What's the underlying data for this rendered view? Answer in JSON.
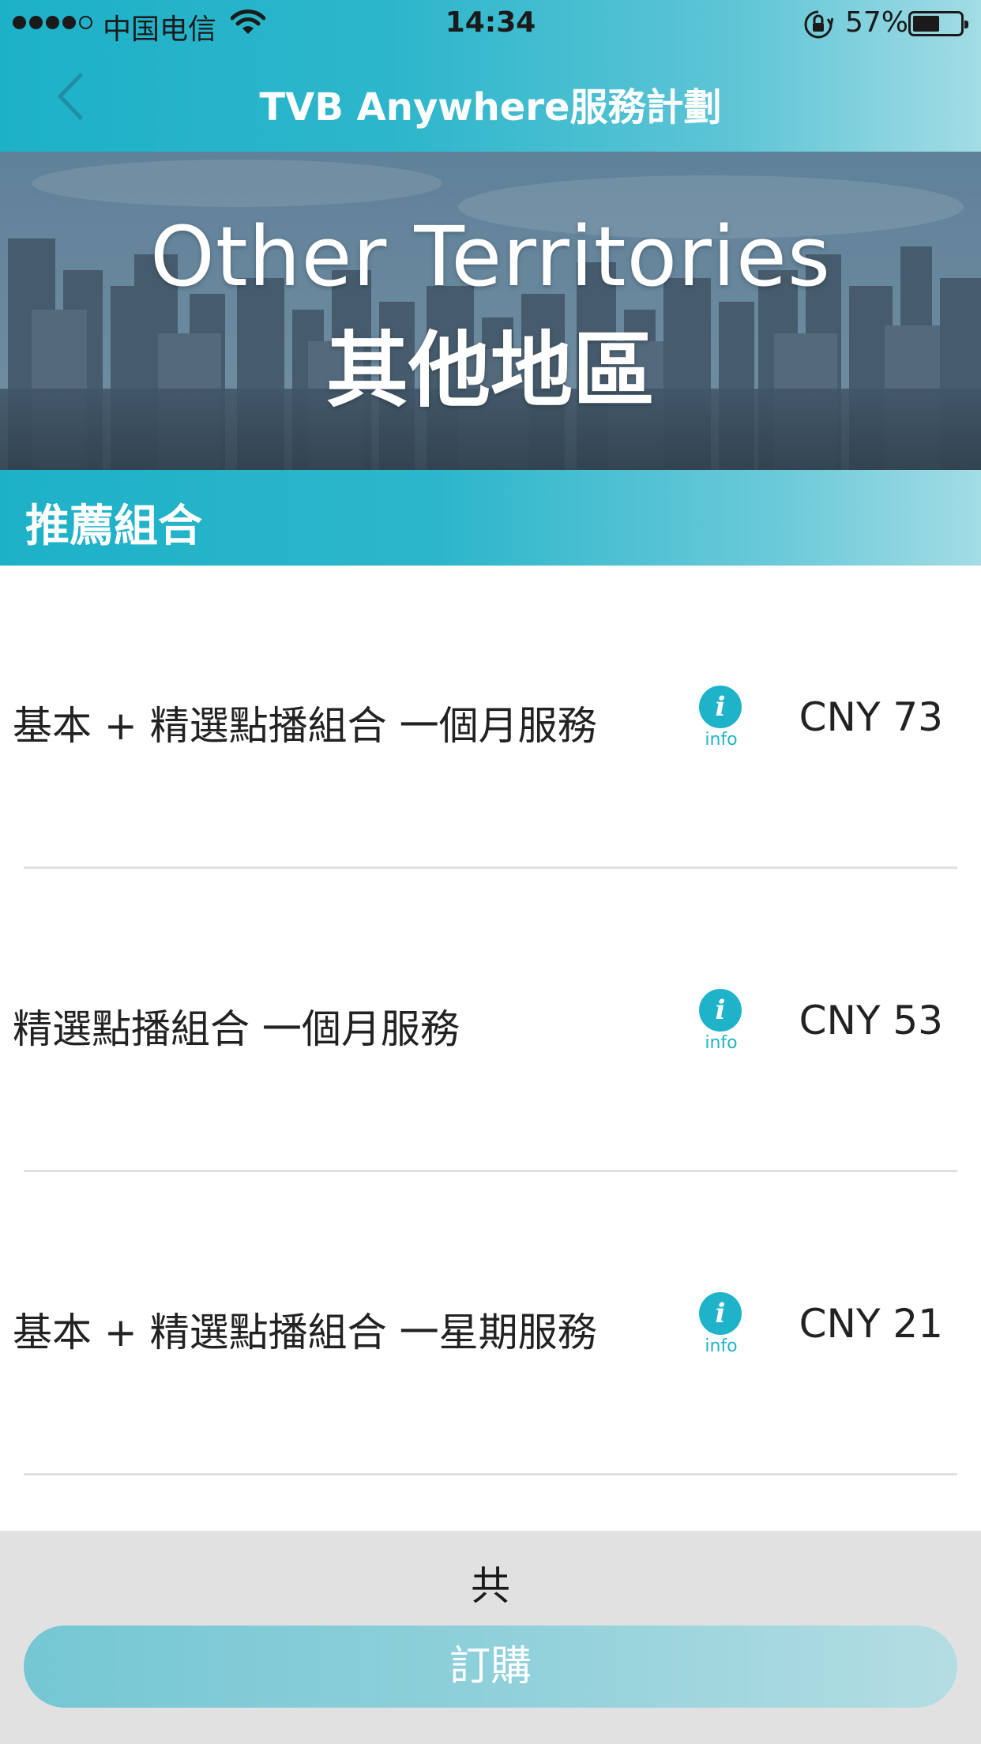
{
  "status_bar": {
    "carrier": "中国电信",
    "time": "14:34",
    "battery_percent": "57%",
    "battery_level": 0.57
  },
  "nav": {
    "title": "TVB Anywhere服務計劃",
    "back_icon": "chevron-left-icon"
  },
  "banner": {
    "title_en": "Other Territories",
    "title_zh": "其他地區"
  },
  "section": {
    "title": "推薦組合"
  },
  "packages": [
    {
      "name": "基本 + 精選點播組合 一個月服務",
      "info_label": "info",
      "price": "CNY 73"
    },
    {
      "name": "精選點播組合 一個月服務",
      "info_label": "info",
      "price": "CNY 53"
    },
    {
      "name": "基本 + 精選點播組合 一星期服務",
      "info_label": "info",
      "price": "CNY 21"
    }
  ],
  "footer": {
    "total_label": "共",
    "order_button": "訂購"
  },
  "colors": {
    "accent": "#1fb3c9",
    "accent_light": "#a3dce5",
    "footer_bg": "#e1e1e1"
  }
}
